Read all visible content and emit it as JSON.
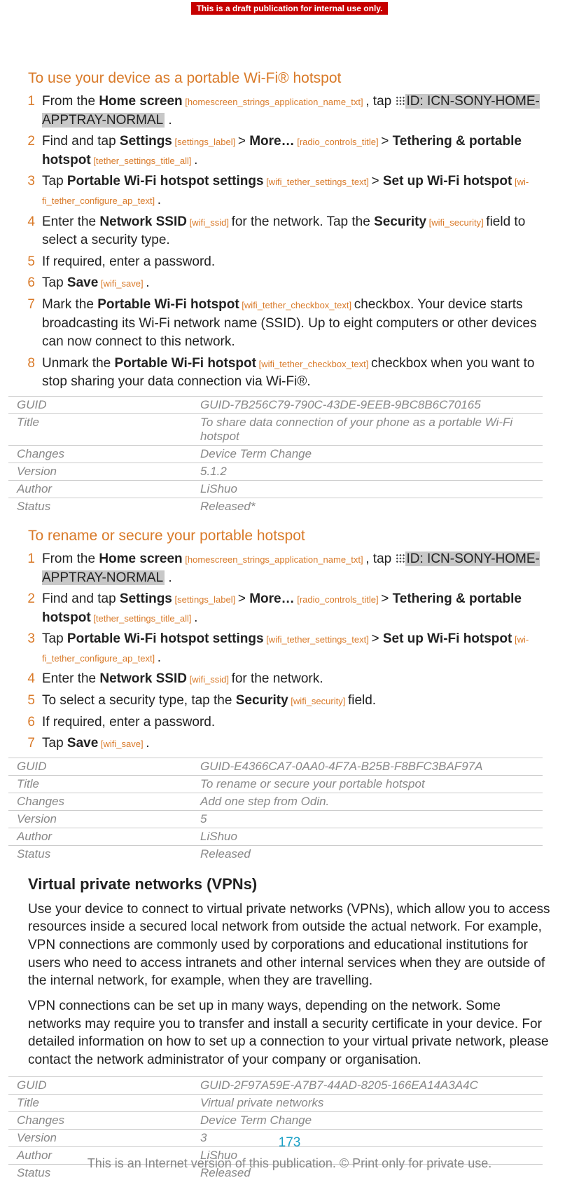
{
  "banner": "This is a draft publication for internal use only.",
  "section1": {
    "title": "To use your device as a portable Wi-Fi® hotspot",
    "steps": [
      {
        "pre": "From the ",
        "kw1": "Home screen",
        "tag1": " [homescreen_strings_application_name_txt] ",
        "mid1": ", tap ",
        "iconId": "ID: ICN-SONY-HOME-APPTRAY-NORMAL",
        "post": " ."
      },
      {
        "pre": "Find and tap ",
        "kw1": "Settings",
        "tag1": " [settings_label] ",
        "sep1": "> ",
        "kw2": "More…",
        "tag2": " [radio_controls_title] ",
        "sep2": "> ",
        "kw3": "Tethering & portable hotspot",
        "tag3": " [tether_settings_title_all] ",
        "post": "."
      },
      {
        "pre": "Tap ",
        "kw1": "Portable Wi-Fi hotspot settings",
        "tag1": " [wifi_tether_settings_text] ",
        "sep1": "> ",
        "kw2": "Set up Wi-Fi hotspot",
        "tag2": " [wi-fi_tether_configure_ap_text] ",
        "post": "."
      },
      {
        "pre": "Enter the ",
        "kw1": "Network SSID",
        "tag1": " [wifi_ssid] ",
        "mid1": "for the network. Tap the ",
        "kw2": "Security",
        "tag2": " [wifi_security] ",
        "post": "field to select a security type."
      },
      {
        "plain": "If required, enter a password."
      },
      {
        "pre": "Tap ",
        "kw1": "Save",
        "tag1": " [wifi_save] ",
        "post": "."
      },
      {
        "pre": "Mark the ",
        "kw1": "Portable Wi-Fi hotspot",
        "tag1": " [wifi_tether_checkbox_text] ",
        "post": "checkbox. Your device starts broadcasting its Wi-Fi network name (SSID). Up to eight computers or other devices can now connect to this network."
      },
      {
        "pre": "Unmark the ",
        "kw1": "Portable Wi-Fi hotspot",
        "tag1": " [wifi_tether_checkbox_text] ",
        "post": "checkbox when you want to stop sharing your data connection via Wi-Fi®."
      }
    ],
    "meta": {
      "GUID": "GUID-7B256C79-790C-43DE-9EEB-9BC8B6C70165",
      "Title": "To share data connection of your phone as a portable Wi-Fi hotspot",
      "Changes": "Device Term Change",
      "Version": "5.1.2",
      "Author": "LiShuo",
      "Status": "Released*"
    }
  },
  "section2": {
    "title": "To rename or secure your portable hotspot",
    "steps": [
      {
        "pre": "From the ",
        "kw1": "Home screen",
        "tag1": " [homescreen_strings_application_name_txt] ",
        "mid1": ", tap ",
        "iconId": "ID: ICN-SONY-HOME-APPTRAY-NORMAL",
        "post": " ."
      },
      {
        "pre": "Find and tap ",
        "kw1": "Settings",
        "tag1": " [settings_label] ",
        "sep1": "> ",
        "kw2": "More…",
        "tag2": " [radio_controls_title] ",
        "sep2": "> ",
        "kw3": "Tethering & portable hotspot",
        "tag3": " [tether_settings_title_all] ",
        "post": "."
      },
      {
        "pre": "Tap ",
        "kw1": "Portable Wi-Fi hotspot settings",
        "tag1": " [wifi_tether_settings_text] ",
        "sep1": "> ",
        "kw2": "Set up Wi-Fi hotspot",
        "tag2": " [wi-fi_tether_configure_ap_text] ",
        "post": "."
      },
      {
        "pre": "Enter the ",
        "kw1": "Network SSID",
        "tag1": " [wifi_ssid] ",
        "post": "for the network."
      },
      {
        "pre": "To select a security type, tap the ",
        "kw1": "Security",
        "tag1": " [wifi_security] ",
        "post": "field."
      },
      {
        "plain": "If required, enter a password."
      },
      {
        "pre": "Tap ",
        "kw1": "Save",
        "tag1": " [wifi_save] ",
        "post": "."
      }
    ],
    "meta": {
      "GUID": "GUID-E4366CA7-0AA0-4F7A-B25B-F8BFC3BAF97A",
      "Title": "To rename or secure your portable hotspot",
      "Changes": "Add one step from Odin.",
      "Version": "5",
      "Author": "LiShuo",
      "Status": "Released"
    }
  },
  "section3": {
    "heading": "Virtual private networks (VPNs)",
    "p1": "Use your device to connect to virtual private networks (VPNs), which allow you to access resources inside a secured local network from outside the actual network. For example, VPN connections are commonly used by corporations and educational institutions for users who need to access intranets and other internal services when they are outside of the internal network, for example, when they are travelling.",
    "p2": "VPN connections can be set up in many ways, depending on the network. Some networks may require you to transfer and install a security certificate in your device. For detailed information on how to set up a connection to your virtual private network, please contact the network administrator of your company or organisation.",
    "meta": {
      "GUID": "GUID-2F97A59E-A7B7-44AD-8205-166EA14A3A4C",
      "Title": "Virtual private networks",
      "Changes": "Device Term Change",
      "Version": "3",
      "Author": "LiShuo",
      "Status": "Released"
    }
  },
  "metaLabels": {
    "guid": "GUID",
    "title": "Title",
    "changes": "Changes",
    "version": "Version",
    "author": "Author",
    "status": "Status"
  },
  "footer": {
    "page": "173",
    "copy": "This is an Internet version of this publication. © Print only for private use."
  }
}
